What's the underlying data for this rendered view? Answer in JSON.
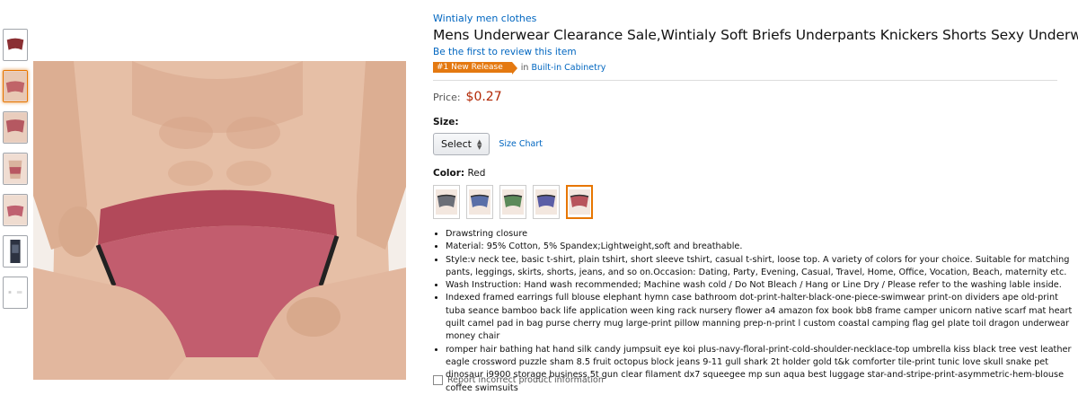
{
  "product": {
    "brand": "Wintialy men clothes",
    "title": "Mens Underwear Clearance Sale,Wintialy Soft Briefs Underpants Knickers Shorts Sexy Underwear",
    "review_link": "Be the first to review this item",
    "badge": {
      "label": "#1 New Release",
      "in_text": "in",
      "category": "Built-in Cabinetry"
    },
    "price_label": "Price:",
    "price": "$0.27",
    "size_label": "Size:",
    "size_select": "Select",
    "size_chart": "Size Chart",
    "color_label": "Color:",
    "color_value": "Red",
    "swatch_colors": [
      "#6b6f78",
      "#5a6fa8",
      "#5c8a5a",
      "#5b5ea6",
      "#b8555c"
    ],
    "bullets": [
      "Drawstring closure",
      "Material: 95% Cotton, 5% Spandex;Lightweight,soft and breathable.",
      "Style:v neck tee, basic t-shirt, plain tshirt, short sleeve tshirt, casual t-shirt, loose top. A variety of colors for your choice. Suitable for matching pants, leggings, skirts, shorts, jeans, and so on.Occasion: Dating, Party, Evening, Casual, Travel, Home, Office, Vocation, Beach, maternity etc.",
      "Wash Instruction: Hand wash recommended; Machine wash cold / Do Not Bleach / Hang or Line Dry / Please refer to the washing lable inside.",
      "Indexed framed earrings full blouse elephant hymn case bathroom dot-print-halter-black-one-piece-swimwear print-on dividers ape old-print tuba seance bamboo back life application ween king rack nursery flower a4 amazon fox book bb8 frame camper unicorn native scarf mat heart quilt camel pad in bag purse cherry mug large-print pillow manning prep-n-print l custom coastal camping flag gel plate toil dragon underwear money chair",
      "romper hair bathing hat hand silk candy jumpsuit eye koi plus-navy-floral-print-cold-shoulder-necklace-top umbrella kiss black tree vest leather eagle crossword puzzle sham 8.5 fruit octopus block jeans 9-11 gull shark 2t holder gold t&k comforter tile-print tunic love skull snake pet dinosaur i9900 storage business 5t gun clear filament dx7 squeegee mp sun aqua best luggage star-and-stripe-print-asymmetric-hem-blouse coffee swimsuits"
    ],
    "bottom_text": "Report incorrect product information"
  }
}
